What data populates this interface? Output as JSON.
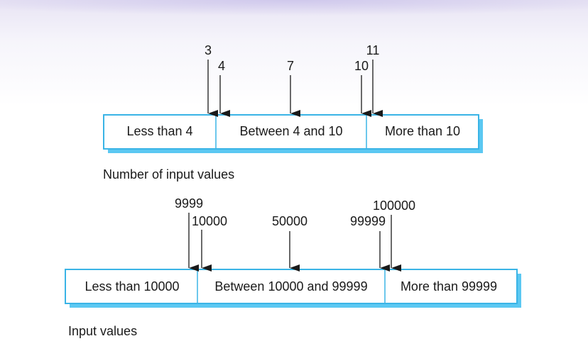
{
  "colors": {
    "box_border": "#3ab4e6",
    "box_fill": "#ffffff",
    "box_shadow": "#5bc8f2",
    "background_tint": "#e8e4f4"
  },
  "diagram_top": {
    "caption": "Number of input values",
    "partitions": [
      "Less than 4",
      "Between 4 and 10",
      "More than 10"
    ],
    "markers": [
      "3",
      "4",
      "7",
      "10",
      "11"
    ]
  },
  "diagram_bottom": {
    "caption": "Input values",
    "partitions": [
      "Less than 10000",
      "Between 10000 and 99999",
      "More than 99999"
    ],
    "markers": [
      "9999",
      "10000",
      "50000",
      "99999",
      "100000"
    ]
  }
}
